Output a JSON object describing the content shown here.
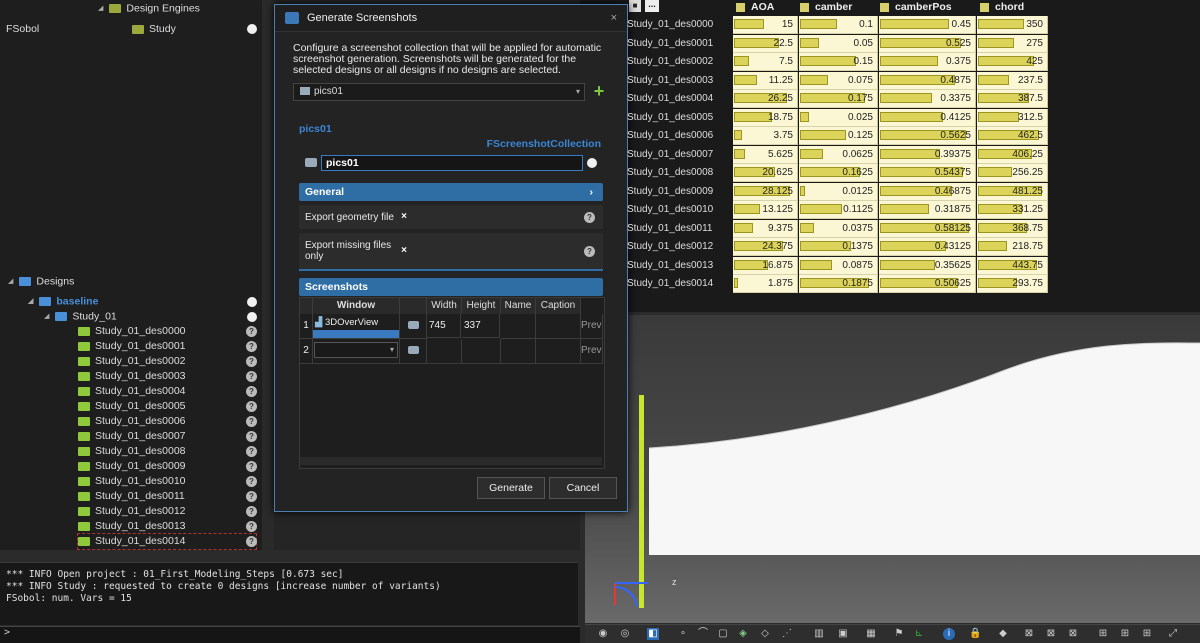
{
  "tree": {
    "design_engines": "Design Engines",
    "fsobol": "FSobol",
    "study": "Study",
    "designs": "Designs",
    "baseline": "baseline",
    "study01": "Study_01",
    "designs_list": [
      "Study_01_des0000",
      "Study_01_des0001",
      "Study_01_des0002",
      "Study_01_des0003",
      "Study_01_des0004",
      "Study_01_des0005",
      "Study_01_des0006",
      "Study_01_des0007",
      "Study_01_des0008",
      "Study_01_des0009",
      "Study_01_des0010",
      "Study_01_des0011",
      "Study_01_des0012",
      "Study_01_des0013",
      "Study_01_des0014"
    ]
  },
  "console": {
    "lines": [
      "*** INFO Open project : 01_First_Modeling_Steps [0.673 sec]",
      "*** INFO Study : requested to create 0 designs [increase number of variants)",
      "FSobol: num. Vars = 15"
    ],
    "prompt": ">"
  },
  "table": {
    "headers": [
      "AOA",
      "camber",
      "camberPos",
      "chord"
    ],
    "corner": "...",
    "rows": [
      {
        "name": "Study_01_des0000",
        "aoa": "15",
        "camber": "0.1",
        "camberPos": "0.45",
        "chord": "350"
      },
      {
        "name": "Study_01_des0001",
        "aoa": "22.5",
        "camber": "0.05",
        "camberPos": "0.525",
        "chord": "275"
      },
      {
        "name": "Study_01_des0002",
        "aoa": "7.5",
        "camber": "0.15",
        "camberPos": "0.375",
        "chord": "425"
      },
      {
        "name": "Study_01_des0003",
        "aoa": "11.25",
        "camber": "0.075",
        "camberPos": "0.4875",
        "chord": "237.5"
      },
      {
        "name": "Study_01_des0004",
        "aoa": "26.25",
        "camber": "0.175",
        "camberPos": "0.3375",
        "chord": "387.5"
      },
      {
        "name": "Study_01_des0005",
        "aoa": "18.75",
        "camber": "0.025",
        "camberPos": "0.4125",
        "chord": "312.5"
      },
      {
        "name": "Study_01_des0006",
        "aoa": "3.75",
        "camber": "0.125",
        "camberPos": "0.5625",
        "chord": "462.5"
      },
      {
        "name": "Study_01_des0007",
        "aoa": "5.625",
        "camber": "0.0625",
        "camberPos": "0.39375",
        "chord": "406.25"
      },
      {
        "name": "Study_01_des0008",
        "aoa": "20.625",
        "camber": "0.1625",
        "camberPos": "0.54375",
        "chord": "256.25"
      },
      {
        "name": "Study_01_des0009",
        "aoa": "28.125",
        "camber": "0.0125",
        "camberPos": "0.46875",
        "chord": "481.25"
      },
      {
        "name": "Study_01_des0010",
        "aoa": "13.125",
        "camber": "0.1125",
        "camberPos": "0.31875",
        "chord": "331.25"
      },
      {
        "name": "Study_01_des0011",
        "aoa": "9.375",
        "camber": "0.0375",
        "camberPos": "0.58125",
        "chord": "368.75"
      },
      {
        "name": "Study_01_des0012",
        "aoa": "24.375",
        "camber": "0.1375",
        "camberPos": "0.43125",
        "chord": "218.75"
      },
      {
        "name": "Study_01_des0013",
        "aoa": "16.875",
        "camber": "0.0875",
        "camberPos": "0.35625",
        "chord": "443.75"
      },
      {
        "name": "Study_01_des0014",
        "aoa": "1.875",
        "camber": "0.1875",
        "camberPos": "0.50625",
        "chord": "293.75"
      }
    ]
  },
  "dialog": {
    "title": "Generate Screenshots",
    "close": "×",
    "description": "Configure a screenshot collection that will be applied for automatic screenshot generation. Screenshots will be generated for the selected designs or all designs if no designs are selected.",
    "collection_select": "pics01",
    "add": "+",
    "object_name": "pics01",
    "object_type": "FScreenshotCollection",
    "name_value": "pics01",
    "general": "General",
    "general_chevron": "›",
    "export_geometry": "Export geometry file",
    "export_missing": "Export missing files only",
    "checkmark": "×",
    "help": "?",
    "screenshots": "Screenshots",
    "grid_headers": [
      "Window",
      "Width",
      "Height",
      "Name",
      "Caption"
    ],
    "grid_rows": [
      {
        "idx": "1",
        "window": "3DOverView",
        "width": "745",
        "height": "337",
        "name": "",
        "caption": "",
        "extra": "Prev"
      },
      {
        "idx": "2",
        "window": "",
        "width": "",
        "height": "",
        "name": "",
        "caption": "",
        "extra": "Prev"
      }
    ],
    "generate": "Generate",
    "cancel": "Cancel"
  },
  "viewport": {
    "axis_z": "z"
  }
}
